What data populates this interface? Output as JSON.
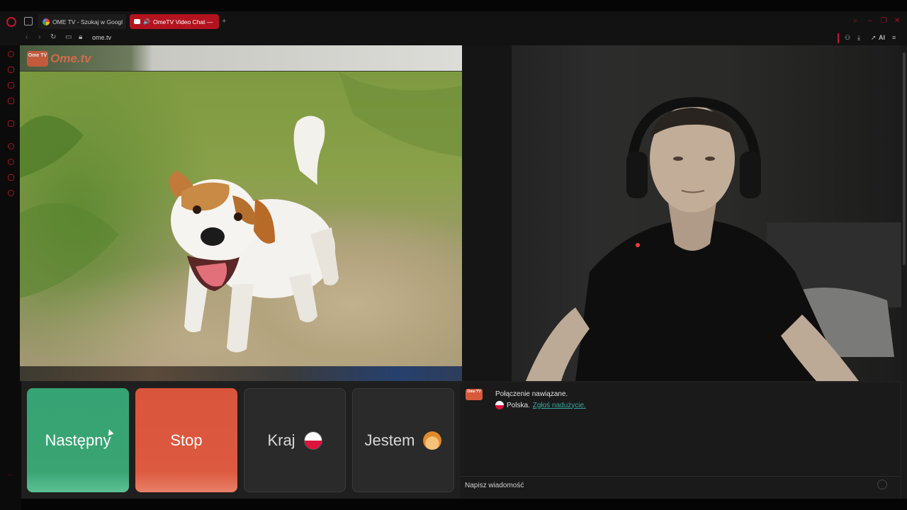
{
  "browser": {
    "tabs": [
      {
        "label": "OME TV - Szukaj w Googl",
        "favicon": "google-icon",
        "active": false
      },
      {
        "label": "OmeTV Video Chat —",
        "favicon": "ometv-icon",
        "active": true
      }
    ],
    "new_tab_label": "+",
    "url": "ome.tv",
    "toolbar_ai_label": "AI"
  },
  "video": {
    "logo_box_text": "Ome TV",
    "logo_text": "Ome.tv"
  },
  "controls": {
    "next_label": "Następny",
    "stop_label": "Stop",
    "country_label": "Kraj",
    "gender_label": "Jestem"
  },
  "chat": {
    "logo_text": "Ome TV",
    "connection_status": "Połączenie nawiązane.",
    "country": "Polska.",
    "report_link": "Zgłoś nadużycie.",
    "message_placeholder": "Napisz wiadomość"
  },
  "colors": {
    "accent": "#c2162b",
    "next_button": "#36a374",
    "stop_button": "#d9553c",
    "report_link": "#38a8a0"
  }
}
